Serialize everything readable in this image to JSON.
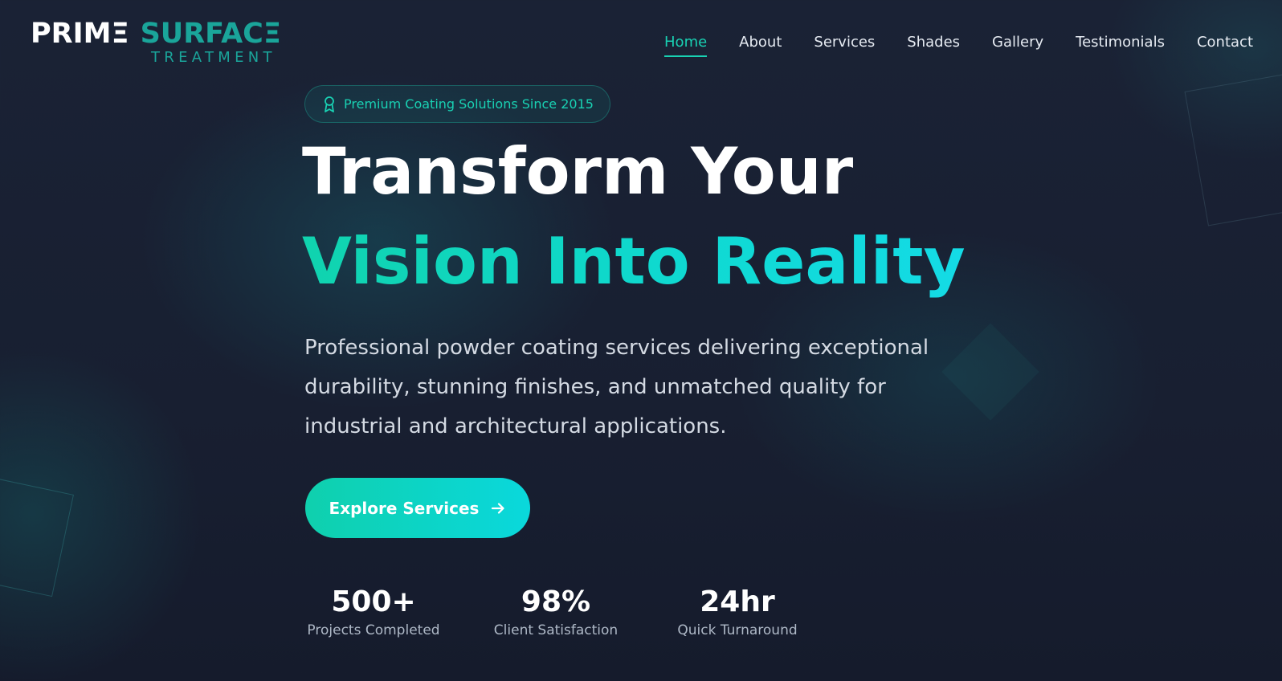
{
  "brand": {
    "logo_prim": "PRIM",
    "logo_e": "Ξ",
    "logo_surface": "SURFACΞ",
    "logo_sub": "TREATMENT",
    "accent_color": "#19d1b3"
  },
  "nav": {
    "items": [
      {
        "label": "Home",
        "active": true
      },
      {
        "label": "About",
        "active": false
      },
      {
        "label": "Services",
        "active": false
      },
      {
        "label": "Shades",
        "active": false
      },
      {
        "label": "Gallery",
        "active": false
      },
      {
        "label": "Testimonials",
        "active": false
      },
      {
        "label": "Contact",
        "active": false
      }
    ]
  },
  "hero": {
    "badge_icon": "award-ribbon-icon",
    "badge_text": "Premium Coating Solutions Since 2015",
    "headline_line1": "Transform Your",
    "headline_line2": "Vision Into Reality",
    "description": "Professional powder coating services delivering exceptional durability, stunning finishes, and unmatched quality for industrial and architectural applications.",
    "cta_label": "Explore Services",
    "cta_icon": "arrow-right-icon"
  },
  "stats": [
    {
      "value": "500+",
      "label": "Projects Completed"
    },
    {
      "value": "98%",
      "label": "Client Satisfaction"
    },
    {
      "value": "24hr",
      "label": "Quick Turnaround"
    }
  ]
}
